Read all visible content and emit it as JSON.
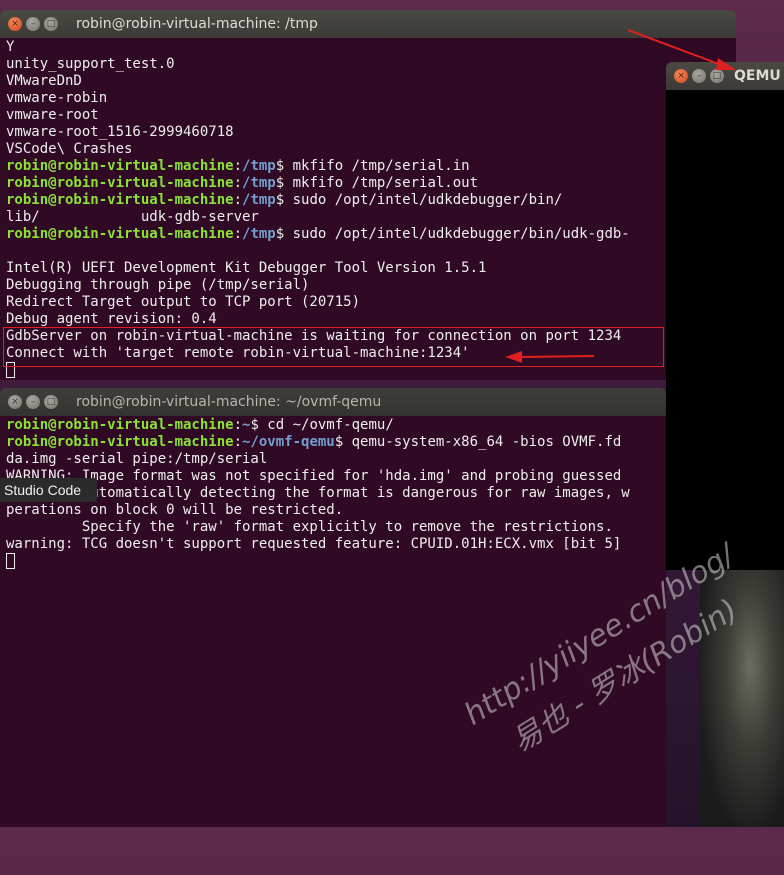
{
  "terminal1": {
    "title": "robin@robin-virtual-machine: /tmp",
    "lines": [
      [
        "Y"
      ],
      [
        "unity_support_test.0"
      ],
      [
        "VMwareDnD"
      ],
      [
        "vmware-robin"
      ],
      [
        "vmware-root"
      ],
      [
        "vmware-root_1516-2999460718"
      ],
      [
        "VSCode\\ Crashes"
      ],
      [
        "robin@robin-virtual-machine",
        ":",
        "/tmp",
        "$ mkfifo /tmp/serial.in"
      ],
      [
        "robin@robin-virtual-machine",
        ":",
        "/tmp",
        "$ mkfifo /tmp/serial.out"
      ],
      [
        "robin@robin-virtual-machine",
        ":",
        "/tmp",
        "$ sudo /opt/intel/udkdebugger/bin/"
      ],
      [
        "lib/            udk-gdb-server"
      ],
      [
        "robin@robin-virtual-machine",
        ":",
        "/tmp",
        "$ sudo /opt/intel/udkdebugger/bin/udk-gdb-"
      ],
      [
        ""
      ],
      [
        "Intel(R) UEFI Development Kit Debugger Tool Version 1.5.1"
      ],
      [
        "Debugging through pipe (/tmp/serial)"
      ],
      [
        "Redirect Target output to TCP port (20715)"
      ],
      [
        "Debug agent revision: 0.4"
      ],
      [
        "GdbServer on robin-virtual-machine is waiting for connection on port 1234"
      ],
      [
        "Connect with 'target remote robin-virtual-machine:1234'"
      ]
    ]
  },
  "terminal2": {
    "title": "robin@robin-virtual-machine: ~/ovmf-qemu",
    "lines": [
      [
        "robin@robin-virtual-machine",
        ":",
        "~",
        "$ cd ~/ovmf-qemu/"
      ],
      [
        "robin@robin-virtual-machine",
        ":",
        "~/ovmf-qemu",
        "$ qemu-system-x86_64 -bios OVMF.fd"
      ],
      [
        "da.img -serial pipe:/tmp/serial"
      ],
      [
        "WARNING: Image format was not specified for 'hda.img' and probing guessed"
      ],
      [
        "         Automatically detecting the format is dangerous for raw images, w"
      ],
      [
        "perations on block 0 will be restricted."
      ],
      [
        "         Specify the 'raw' format explicitly to remove the restrictions."
      ],
      [
        "warning: TCG doesn't support requested feature: CPUID.01H:ECX.vmx [bit 5]"
      ]
    ]
  },
  "qemu": {
    "title": "QEMU"
  },
  "tooltip": {
    "text": "Studio Code"
  },
  "watermark": {
    "line1": "http://yiiyee.cn/blog/",
    "line2": "易也 - 罗冰(Robin)"
  },
  "window_buttons": {
    "close": "×",
    "minimize": "–",
    "maximize": "□"
  },
  "colors": {
    "terminal_bg": "#300a24",
    "user_green": "#8ae234",
    "path_blue": "#729fcf",
    "highlight_red": "#e02020"
  }
}
